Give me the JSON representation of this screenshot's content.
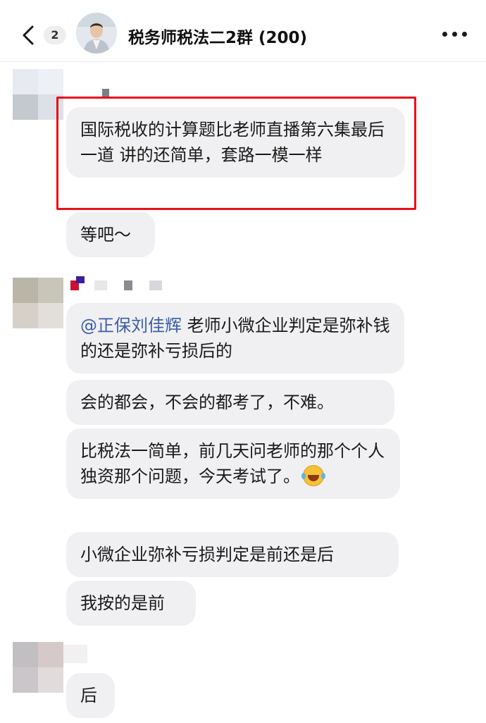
{
  "header": {
    "back_label": "back",
    "unread_count": "2",
    "group_title": "税务师税法二2群 (200)"
  },
  "messages": [
    {
      "id": "m1",
      "text": "国际税收的计算题比老师直播第六集最后一道 讲的还简单，套路一模一样"
    },
    {
      "id": "m2",
      "text": "等吧～"
    },
    {
      "id": "m3",
      "mention": "@正保刘佳辉",
      "text": " 老师小微企业判定是弥补钱的还是弥补亏损后的"
    },
    {
      "id": "m4",
      "text": "会的都会，不会的都考了，不难。"
    },
    {
      "id": "m5",
      "text": "比税法一简单，前几天问老师的那个个人独资那个问题，今天考试了。"
    },
    {
      "id": "m6",
      "text": "小微企业弥补亏损判定是前还是后"
    },
    {
      "id": "m7",
      "text": "我按的是前"
    },
    {
      "id": "m8",
      "text": "后"
    }
  ],
  "highlight_color": "#e8101a",
  "bubble_color": "#f0f0f2",
  "mention_color": "#3a5fa8"
}
